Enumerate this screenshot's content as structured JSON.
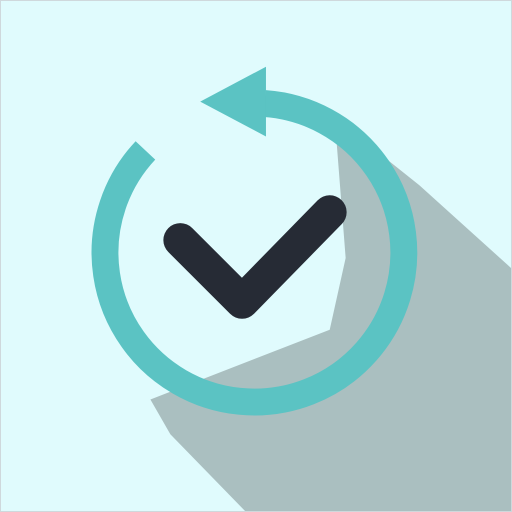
{
  "icon": {
    "name": "refresh-check-icon",
    "colors": {
      "background": "#E0FBFD",
      "shadow": "#AABFC0",
      "ring": "#5BC3C3",
      "check": "#262B35"
    }
  }
}
